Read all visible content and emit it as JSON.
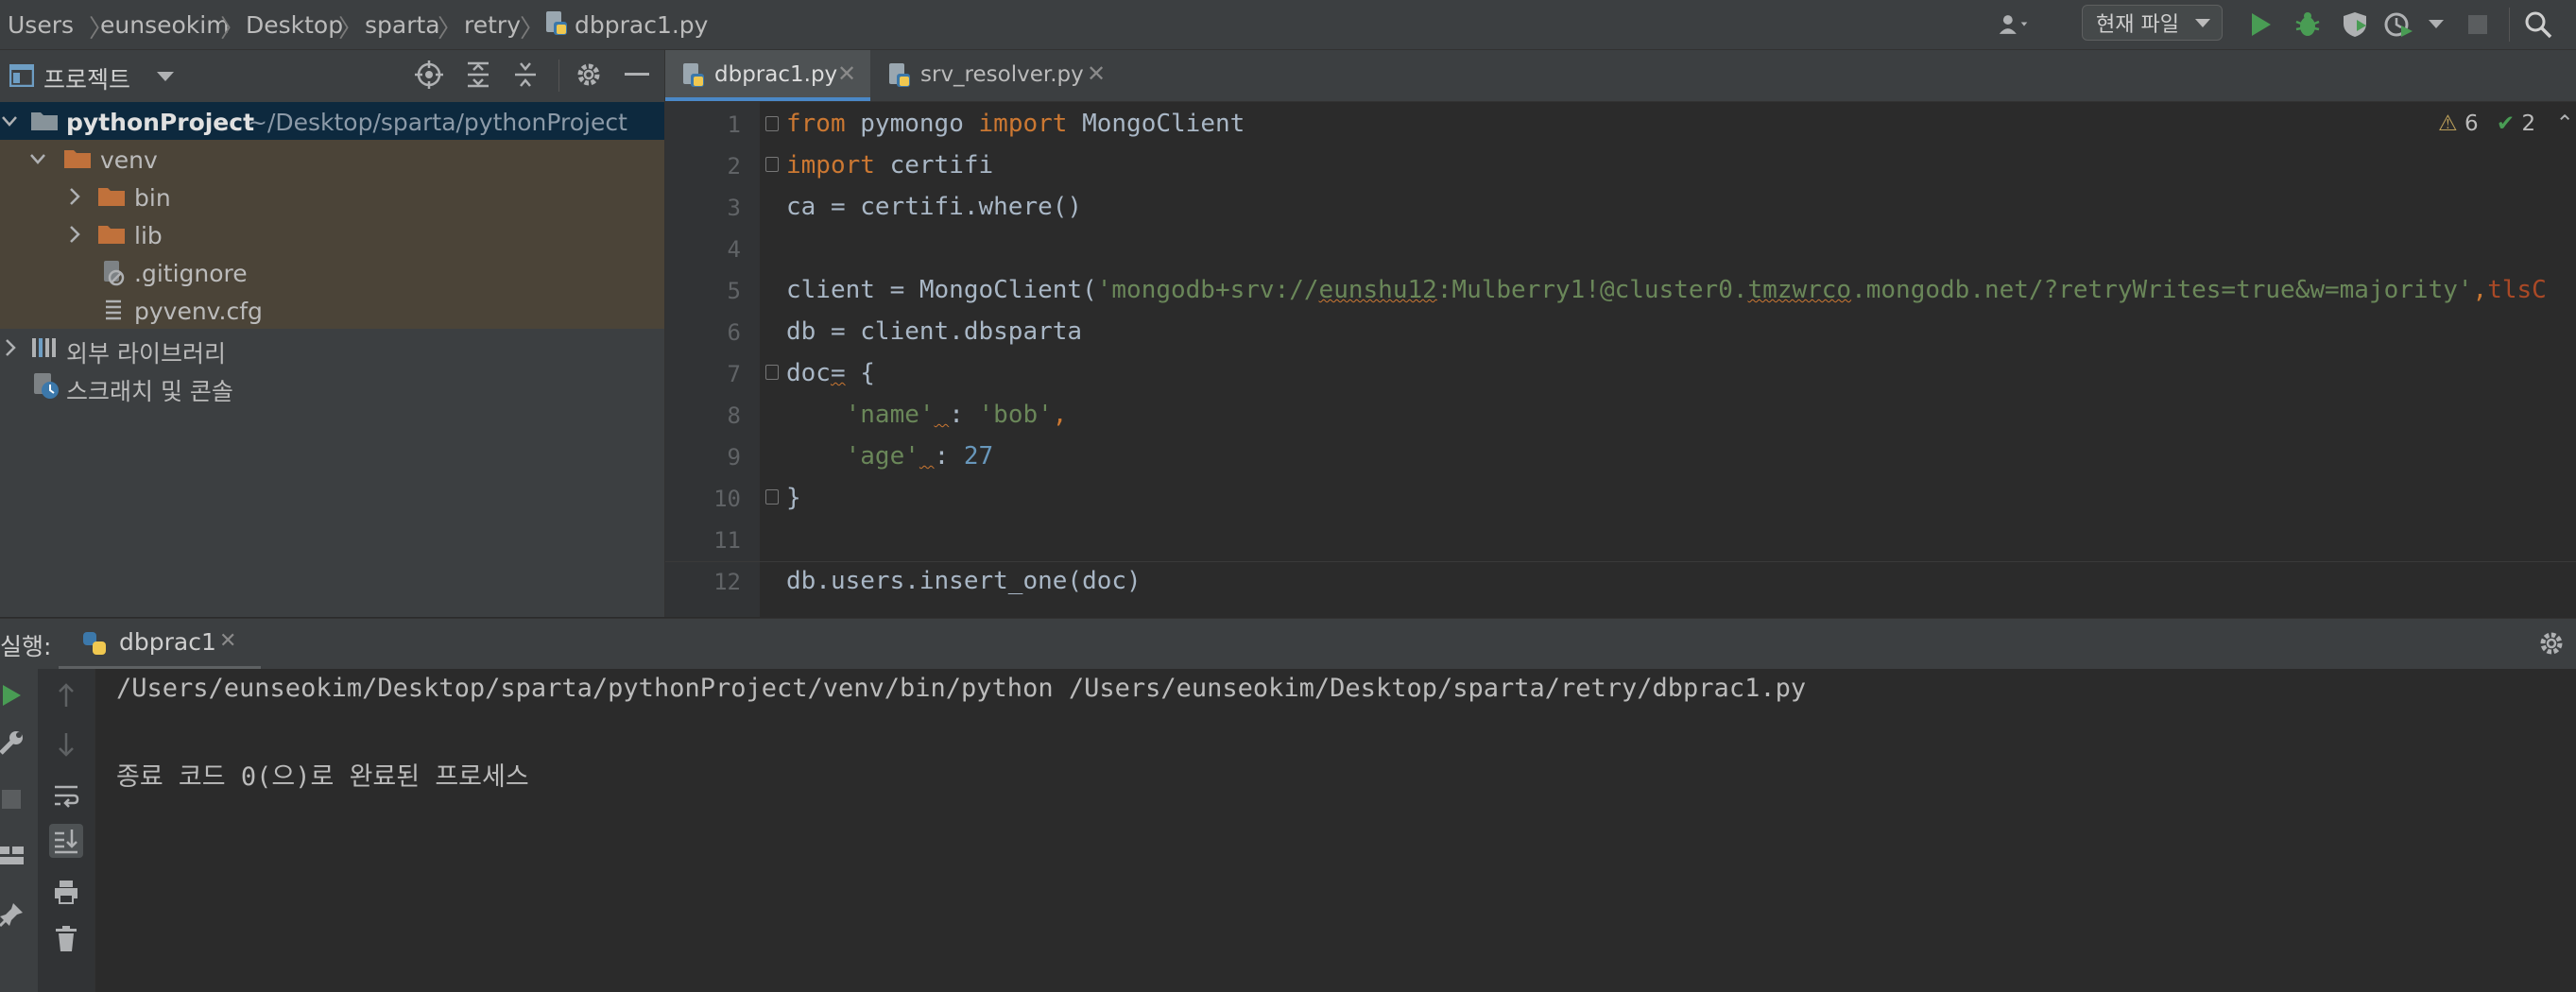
{
  "breadcrumb": [
    "Users",
    "eunseokim",
    "Desktop",
    "sparta",
    "retry",
    "dbprac1.py"
  ],
  "toolbar": {
    "run_config": "현재 파일"
  },
  "project": {
    "title": "프로젝트",
    "root_name": "pythonProject",
    "root_path": "~/Desktop/sparta/pythonProject",
    "items": [
      "venv",
      "bin",
      "lib",
      ".gitignore",
      "pyvenv.cfg"
    ],
    "external_libraries": "외부 라이브러리",
    "scratches": "스크래치 및 콘솔"
  },
  "tabs": [
    {
      "label": "dbprac1.py",
      "active": true
    },
    {
      "label": "srv_resolver.py",
      "active": false
    }
  ],
  "inspection": {
    "warnings": "6",
    "ok": "2"
  },
  "editor": {
    "line_numbers": [
      "1",
      "2",
      "3",
      "4",
      "5",
      "6",
      "7",
      "8",
      "9",
      "10",
      "11",
      "12"
    ],
    "lines": [
      "from pymongo import MongoClient",
      "import certifi",
      "ca = certifi.where()",
      "",
      "client = MongoClient('mongodb+srv://eunshu12:Mulberry1!@cluster0.tmzwrco.mongodb.net/?retryWrites=true&w=majority',tlsC",
      "db = client.dbsparta",
      "doc= {",
      "    'name' : 'bob',",
      "    'age' : 27",
      "}",
      "",
      "db.users.insert_one(doc)"
    ]
  },
  "run": {
    "label": "실행:",
    "tab": "dbprac1",
    "output": [
      "/Users/eunseokim/Desktop/sparta/pythonProject/venv/bin/python /Users/eunseokim/Desktop/sparta/retry/dbprac1.py",
      "",
      "종료 코드 0(으)로 완료된 프로세스"
    ]
  },
  "colors": {
    "keyword": "#cc7832",
    "string": "#6a8759",
    "number": "#6897bb",
    "selection": "#0d293e",
    "run_green": "#499c54"
  }
}
